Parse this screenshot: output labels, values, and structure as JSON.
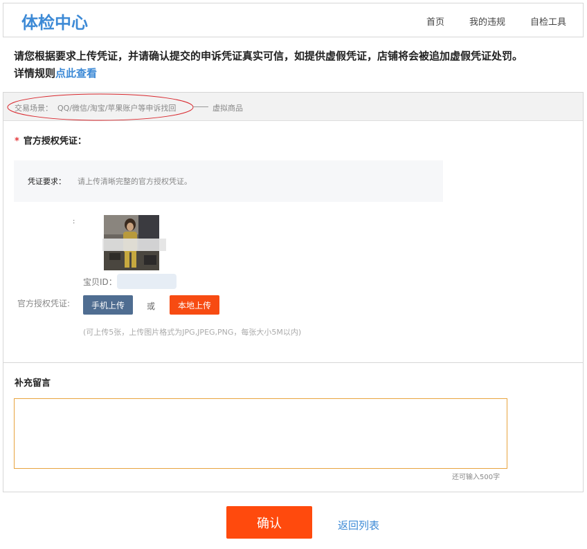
{
  "header": {
    "logo": "体检中心",
    "nav": [
      "首页",
      "我的违规",
      "自检工具"
    ]
  },
  "notice": {
    "text": "请您根据要求上传凭证，并请确认提交的申诉凭证真实可信，如提供虚假凭证，店铺将会被追加虚假凭证处罚。",
    "detail_prefix": "详情规则",
    "detail_link": "点此查看"
  },
  "scene": {
    "label": "交易场景：",
    "value": "QQ/微信/淘宝/苹果账户等申诉找回",
    "sub": "虚拟商品"
  },
  "credential": {
    "required_mark": "*",
    "title": "官方授权凭证：",
    "requirement_label": "凭证要求：",
    "requirement_text": "请上传清晰完整的官方授权凭证。",
    "colon": ":",
    "item_id_label": "宝贝ID：",
    "auth_label": "官方授权凭证:",
    "phone_upload": "手机上传",
    "or": "或",
    "local_upload": "本地上传",
    "upload_hint": "(可上传5张，上传图片格式为JPG,JPEG,PNG，每张大小5M以内)"
  },
  "remark": {
    "title": "补充留言",
    "value": "",
    "counter": "还可输入500字"
  },
  "footer": {
    "confirm": "确认",
    "back": "返回列表"
  },
  "colors": {
    "brand_blue": "#3d8ad6",
    "orange": "#ff4a0d",
    "slate": "#4f6d91",
    "annotation_red": "#d9262c"
  }
}
